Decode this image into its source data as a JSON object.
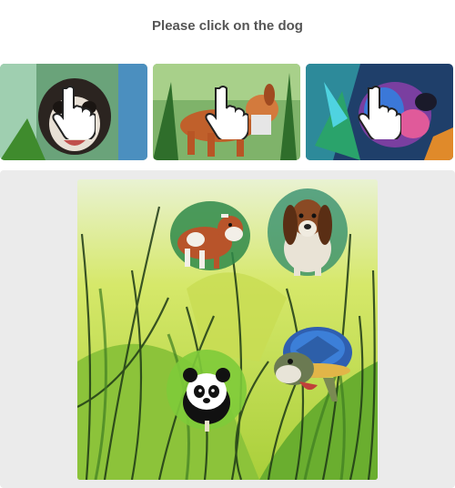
{
  "prompt": {
    "text": "Please click on the dog"
  },
  "thumbnails": [
    {
      "subject": "pug-dog",
      "icon": "pointer-hand-icon"
    },
    {
      "subject": "brown-dog",
      "icon": "pointer-hand-icon"
    },
    {
      "subject": "colorful-dog",
      "icon": "pointer-hand-icon"
    }
  ],
  "scene": {
    "background": "jungle-grass",
    "animals": [
      "cow",
      "basset-hound",
      "panda",
      "turtle"
    ]
  },
  "colors": {
    "prompt_text": "#555555",
    "panel_bg": "#ebebeb",
    "grass_light": "#c9e04a",
    "grass_dark": "#3d7d2a"
  }
}
